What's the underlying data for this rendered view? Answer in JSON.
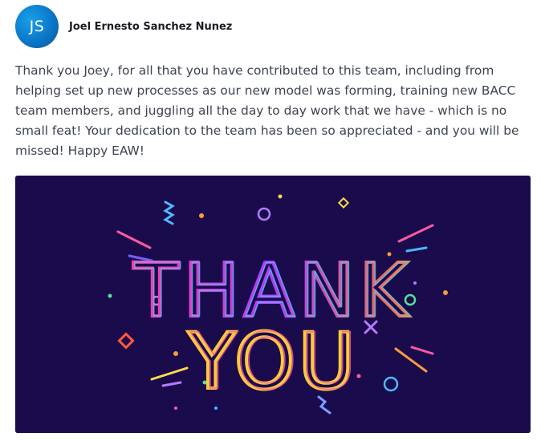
{
  "post": {
    "avatar_initials": "JS",
    "author_name": "Joel Ernesto Sanchez Nunez",
    "message": "Thank you Joey, for all that you have contributed to this team, including from helping set up new processes as our new model was forming, training new BACC team members, and juggling all the day to day work that we have - which is no small feat! Your dedication to the team has been so appreciated - and you will be missed! Happy EAW!"
  },
  "image": {
    "line1": "THANK",
    "line2": "YOU",
    "background_color": "#1a0b4d"
  },
  "colors": {
    "avatar": "#0a77c8",
    "text": "#3d4450",
    "author": "#1b1b24"
  }
}
